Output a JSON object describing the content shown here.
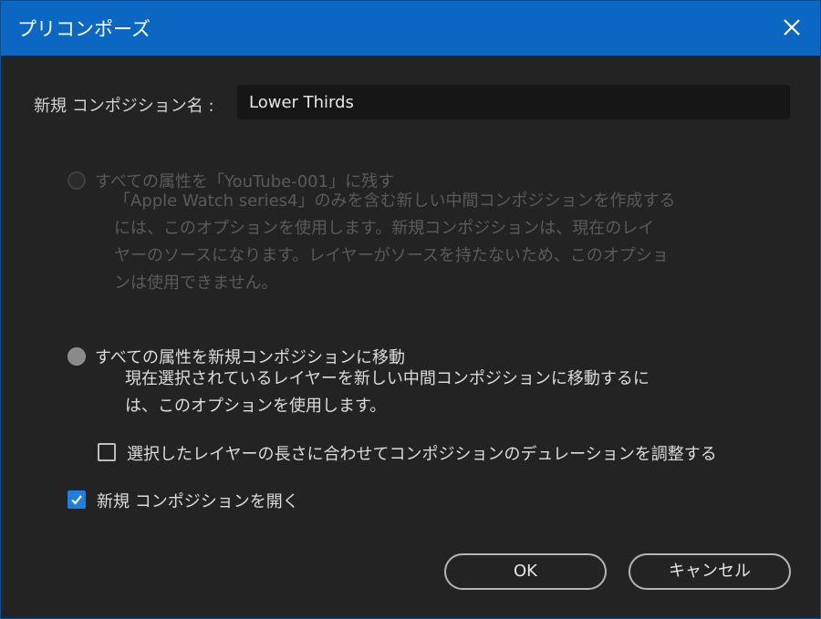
{
  "window": {
    "title": "プリコンポーズ"
  },
  "name_field": {
    "label": "新規 コンポジション名 :",
    "value": "Lower Thirds"
  },
  "option_leave": {
    "title": "すべての属性を「YouTube-001」に残す",
    "description": "「Apple Watch series4」のみを含む新しい中間コンポジションを作成する\nには、このオプションを使用します。新規コンポジションは、現在のレイ\nヤーのソースになります。レイヤーがソースを持たないため、このオプショ\nンは使用できません。",
    "enabled": false,
    "selected": false
  },
  "option_move": {
    "title": "すべての属性を新規コンポジションに移動",
    "description": "現在選択されているレイヤーを新しい中間コンポジションに移動するに\nは、このオプションを使用します。",
    "enabled": true,
    "selected": true
  },
  "adjust_duration": {
    "label": "選択したレイヤーの長さに合わせてコンポジションのデュレーションを調整する",
    "checked": false
  },
  "open_new_comp": {
    "label": "新規 コンポジションを開く",
    "checked": true
  },
  "buttons": {
    "ok": "OK",
    "cancel": "キャンセル"
  },
  "colors": {
    "titlebar": "#0b67c2",
    "background": "#232323",
    "accent": "#1e7fe0"
  },
  "icons": {
    "close": "close-icon",
    "check": "checkmark-icon"
  }
}
